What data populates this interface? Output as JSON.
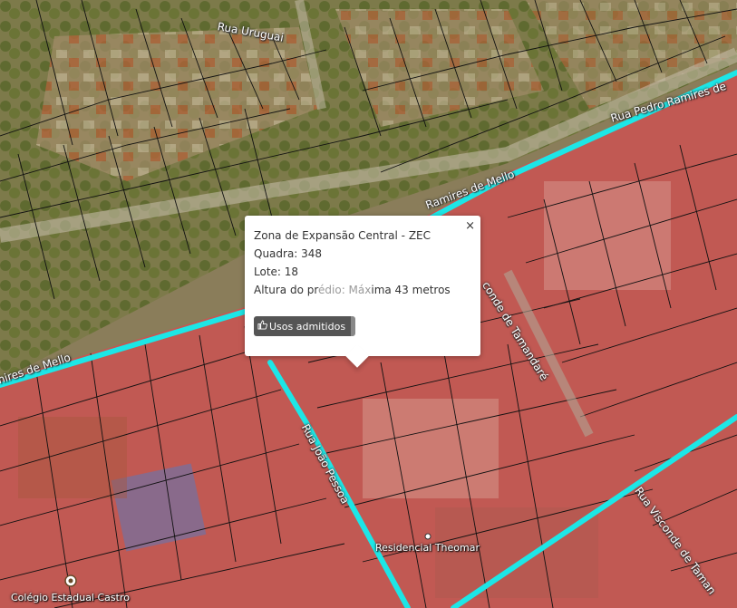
{
  "map": {
    "colors": {
      "aerial_base": "#8a7d5a",
      "vegetation": "#6f7a3c",
      "zone_overlay": "#c84a4a",
      "road_highlight": "#1de6e6",
      "parcel_line": "#111111",
      "road_surface": "#b8b0a0"
    },
    "street_labels": [
      {
        "id": "rua-uruguai",
        "text": "Rua Uruguai"
      },
      {
        "id": "rua-pedro-ramires",
        "text": "Rua Pedro Ramires de"
      },
      {
        "id": "ramires-de-mello-top",
        "text": "Ramires de Mello"
      },
      {
        "id": "ramires-de-mello-left",
        "text": "mires de Mello"
      },
      {
        "id": "visconde-de-tamandare-mid",
        "text": "conde de Tamandaré"
      },
      {
        "id": "rua-joao-pessoa",
        "text": "Rua João Pessoa"
      },
      {
        "id": "rua-visconde-de-tamandare",
        "text": "Rua Visconde de Taman"
      }
    ],
    "poi_labels": [
      {
        "id": "residencial-theomar",
        "text": "Residencial Theomar"
      },
      {
        "id": "colegio-estadual-castro",
        "text": "Colégio Estadual Castro"
      }
    ]
  },
  "popup": {
    "close_symbol": "×",
    "zone": "Zona de Expansão Central - ZEC",
    "quadra": "Quadra: 348",
    "lote": "Lote: 18",
    "altura_prefix": "Altura do pr",
    "altura_muted": "édio: Máx",
    "altura_suffix": "ima 43 metros",
    "usos_button_label": "Usos admitidos",
    "usos_button_icon": "thumbs-up-icon"
  }
}
